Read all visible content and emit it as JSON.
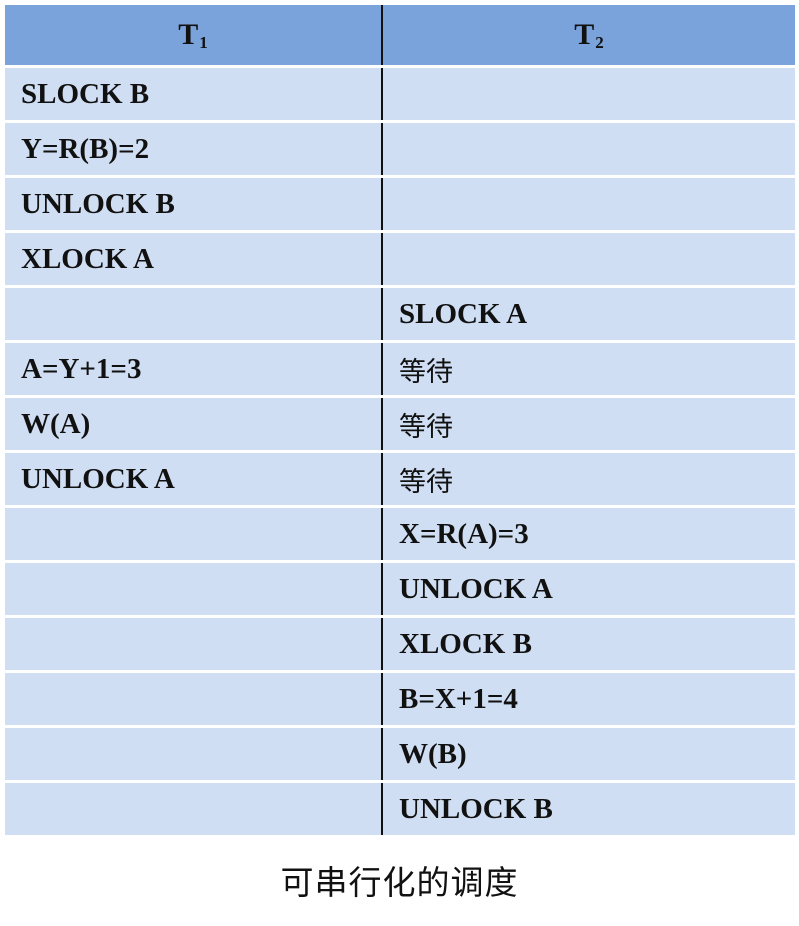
{
  "table": {
    "headers": [
      {
        "main": "T",
        "sub": "1"
      },
      {
        "main": "T",
        "sub": "2"
      }
    ],
    "rows": [
      {
        "t1": "SLOCK B",
        "t2": ""
      },
      {
        "t1": "Y=R(B)=2",
        "t2": ""
      },
      {
        "t1": "UNLOCK B",
        "t2": ""
      },
      {
        "t1": "XLOCK A",
        "t2": ""
      },
      {
        "t1": "",
        "t2": "SLOCK A"
      },
      {
        "t1": "A=Y+1=3",
        "t2": "等待"
      },
      {
        "t1": "W(A)",
        "t2": "等待"
      },
      {
        "t1": "UNLOCK A",
        "t2": "等待"
      },
      {
        "t1": "",
        "t2": "X=R(A)=3"
      },
      {
        "t1": "",
        "t2": "UNLOCK A"
      },
      {
        "t1": "",
        "t2": "XLOCK B"
      },
      {
        "t1": "",
        "t2": "B=X+1=4"
      },
      {
        "t1": "",
        "t2": "W(B)"
      },
      {
        "t1": "",
        "t2": "UNLOCK B"
      }
    ]
  },
  "caption": "可串行化的调度",
  "colors": {
    "header_bg": "#7aa3db",
    "row_bg": "#d0def3",
    "divider": "#111111"
  }
}
